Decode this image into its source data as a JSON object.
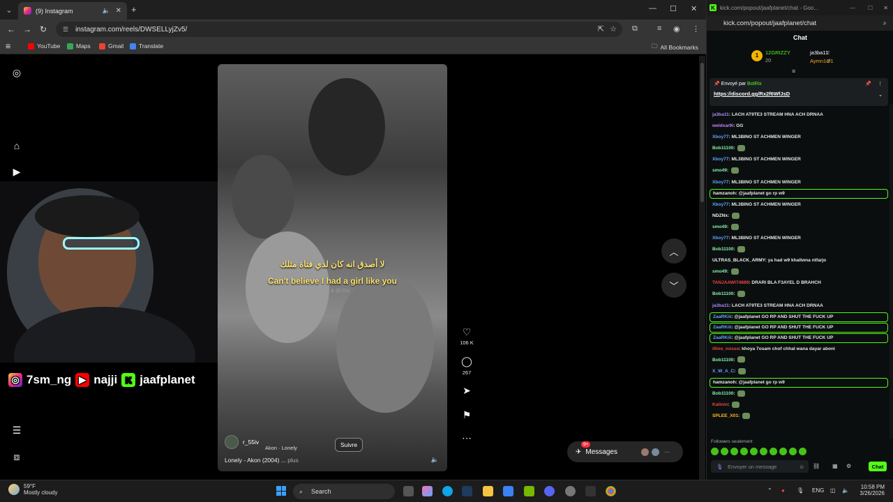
{
  "browser": {
    "tab_title": "(9) Instagram",
    "url": "instagram.com/reels/DWSELLyjZv5/",
    "bookmarks": [
      "YouTube",
      "Maps",
      "Gmail",
      "Translate"
    ],
    "all_bookmarks": "All Bookmarks"
  },
  "reel": {
    "caption_arabic": "لا أصدق انه كان لدي فتاة مثلك",
    "caption_english": "Can't believe I had a girl like you",
    "caption_small": "@r3du & @r33z",
    "username": "r_55iv",
    "audio": "Akon · Lonely",
    "follow_label": "Suivre",
    "description": "Lonely - Akon (2004) ...",
    "more_label": "plus",
    "like_count": "106 K",
    "comment_count": "267",
    "nav_badge": "9+"
  },
  "messages": {
    "label": "Messages",
    "badge": "9+"
  },
  "overlay": {
    "instagram": "7sm_ng",
    "youtube": "najji",
    "kick": "jaafplanet"
  },
  "kick": {
    "window_title": "kick.com/popout/jaafplanet/chat - Goo...",
    "url": "kick.com/popout/jaafplanet/chat",
    "header": "Chat",
    "gift_top": "12GRIZZY",
    "gift_top_count": "20",
    "gift_2": "ja3ba11",
    "gift_2_count": "2",
    "gift_3": "Aymn1of1",
    "gift_3_count": "2",
    "pinned_by": "Envoyé par",
    "pinned_user": "BotRix",
    "pinned_link": "https://discord.gg/Rx2f6WfJsD",
    "followers_only": "Followers seulement",
    "input_placeholder": "Envoyer un message",
    "send_label": "Chat",
    "messages": [
      {
        "user": "ja3ba11",
        "color": "#a78bfa",
        "text": "LACH AT9TE3 STREAM HNA ACH DRNAA",
        "hl": false
      },
      {
        "user": "weldxar9i",
        "color": "#c084fc",
        "text": "GG",
        "hl": false
      },
      {
        "user": "Xboy77",
        "color": "#60a5fa",
        "text": "ML3BINO ST ACHMEN WINGER",
        "hl": false
      },
      {
        "user": "Bob11100",
        "color": "#86efac",
        "text": "",
        "hl": false
      },
      {
        "user": "Xboy77",
        "color": "#60a5fa",
        "text": "ML3BINO ST ACHMEN WINGER",
        "hl": false
      },
      {
        "user": "smo49",
        "color": "#86efac",
        "text": "",
        "hl": false
      },
      {
        "user": "Xboy77",
        "color": "#60a5fa",
        "text": "ML3BINO ST ACHMEN WINGER",
        "hl": false
      },
      {
        "user": "hamzanoh",
        "color": "#f0f0f0",
        "text": "@jaafplanet go rp w9",
        "hl": true
      },
      {
        "user": "Xboy77",
        "color": "#60a5fa",
        "text": "ML3BINO ST ACHMEN WINGER",
        "hl": false
      },
      {
        "user": "NDZNx",
        "color": "#f0f0f0",
        "text": "",
        "hl": false
      },
      {
        "user": "smo49",
        "color": "#86efac",
        "text": "",
        "hl": false
      },
      {
        "user": "Xboy77",
        "color": "#60a5fa",
        "text": "ML3BINO ST ACHMEN WINGER",
        "hl": false
      },
      {
        "user": "Bob11100",
        "color": "#86efac",
        "text": "",
        "hl": false
      },
      {
        "user": "ULTRAS_BLACK_ARMY",
        "color": "#f0f0f0",
        "text": "ya had w9 khallwna ntfarjo",
        "hl": false
      },
      {
        "user": "smo49",
        "color": "#86efac",
        "text": "",
        "hl": false
      },
      {
        "user": "TANJAAWI74889",
        "color": "#ef4444",
        "text": "DRARI BLA F3AYEL D BRAHCH",
        "hl": false
      },
      {
        "user": "Bob11100",
        "color": "#86efac",
        "text": "",
        "hl": false
      },
      {
        "user": "ja3ba11",
        "color": "#a78bfa",
        "text": "LACH AT9TE3 STREAM HNA ACH DRNAA",
        "hl": false
      },
      {
        "user": "ZaaRKiii",
        "color": "#60a5fa",
        "text": "@jaafplanet GO RP AND SHUT THE FUCK UP",
        "hl": true
      },
      {
        "user": "ZaaRKiii",
        "color": "#60a5fa",
        "text": "@jaafplanet GO RP AND SHUT THE FUCK UP",
        "hl": true
      },
      {
        "user": "ZaaRKiii",
        "color": "#60a5fa",
        "text": "@jaafplanet GO RP AND SHUT THE FUCK UP",
        "hl": true
      },
      {
        "user": "illino_nosse",
        "color": "#ef4444",
        "text": "khoya 7osam chof chhal wana dayar aboni",
        "hl": false
      },
      {
        "user": "Bob11100",
        "color": "#86efac",
        "text": "",
        "hl": false
      },
      {
        "user": "X_W_A_C",
        "color": "#60a5fa",
        "text": "",
        "hl": false
      },
      {
        "user": "hamzanoh",
        "color": "#f0f0f0",
        "text": "@jaafplanet go rp w9",
        "hl": true
      },
      {
        "user": "Bob11100",
        "color": "#86efac",
        "text": "",
        "hl": false
      },
      {
        "user": "Kalinin",
        "color": "#ef4444",
        "text": "",
        "hl": false
      },
      {
        "user": "SPLEE_X01",
        "color": "#fbbf24",
        "text": "",
        "hl": false
      }
    ]
  },
  "taskbar": {
    "temp": "59°F",
    "weather": "Mostly cloudy",
    "search": "Search",
    "lang": "ENG",
    "time": "10:58 PM",
    "date": "3/26/2026"
  }
}
